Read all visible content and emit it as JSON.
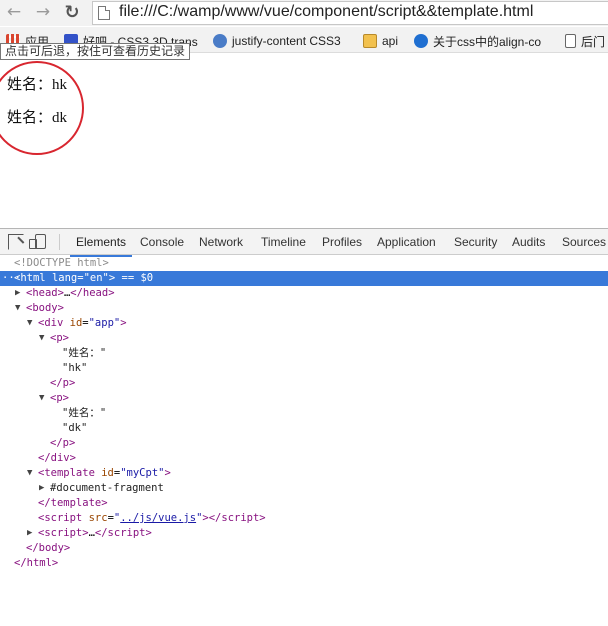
{
  "browser": {
    "url": "file:///C:/wamp/www/vue/component/script&&template.html",
    "tooltip": "点击可后退，按住可查看历史记录",
    "bookmarks": [
      {
        "label": "应用",
        "icon": "apps-icon"
      },
      {
        "label": "好吧 - CSS3 3D trans",
        "icon": "baidu-icon"
      },
      {
        "label": "justify-content CSS3",
        "icon": "compass-icon"
      },
      {
        "label": "api",
        "icon": "folder-icon"
      },
      {
        "label": "关于css中的align-co",
        "icon": "ie-icon"
      },
      {
        "label": "后门",
        "icon": "page-icon"
      }
    ]
  },
  "page": {
    "lines": [
      "姓名：hk",
      "姓名：dk"
    ]
  },
  "devtools": {
    "tabs": [
      "Elements",
      "Console",
      "Network",
      "Timeline",
      "Profiles",
      "Application",
      "Security",
      "Audits",
      "Sources"
    ],
    "active_tab": "Elements",
    "dom_lines": [
      {
        "indent": 14,
        "html": "<span class='comm'>&lt;!DOCTYPE html&gt;</span>"
      },
      {
        "indent": 14,
        "sel": true,
        "prefix": "···",
        "html": "<span class='tag'>&lt;html</span> <span class='attr'>lang</span>=<span class='val'>\"en\"</span><span class='tag'>&gt;</span> == $0"
      },
      {
        "indent": 26,
        "tri": "▶",
        "html": "<span class='tag'>&lt;head&gt;</span>…<span class='tag'>&lt;/head&gt;</span>"
      },
      {
        "indent": 26,
        "tri": "▼",
        "html": "<span class='tag'>&lt;body&gt;</span>"
      },
      {
        "indent": 38,
        "tri": "▼",
        "html": "<span class='tag'>&lt;div</span> <span class='attr'>id</span>=<span class='val'>\"app\"</span><span class='tag'>&gt;</span>"
      },
      {
        "indent": 50,
        "tri": "▼",
        "html": "<span class='tag'>&lt;p&gt;</span>"
      },
      {
        "indent": 62,
        "html": "<span class='txt'>\"姓名：\"</span>"
      },
      {
        "indent": 62,
        "html": "<span class='txt'>\"hk\"</span>"
      },
      {
        "indent": 50,
        "html": "<span class='tag'>&lt;/p&gt;</span>"
      },
      {
        "indent": 50,
        "tri": "▼",
        "html": "<span class='tag'>&lt;p&gt;</span>"
      },
      {
        "indent": 62,
        "html": "<span class='txt'>\"姓名：\"</span>"
      },
      {
        "indent": 62,
        "html": "<span class='txt'>\"dk\"</span>"
      },
      {
        "indent": 50,
        "html": "<span class='tag'>&lt;/p&gt;</span>"
      },
      {
        "indent": 38,
        "html": "<span class='tag'>&lt;/div&gt;</span>"
      },
      {
        "indent": 38,
        "tri": "▼",
        "html": "<span class='tag'>&lt;template</span> <span class='attr'>id</span>=<span class='val'>\"myCpt\"</span><span class='tag'>&gt;</span>"
      },
      {
        "indent": 50,
        "tri": "▶",
        "html": "<span class='txt'>#document-fragment</span>"
      },
      {
        "indent": 38,
        "html": "<span class='tag'>&lt;/template&gt;</span>"
      },
      {
        "indent": 38,
        "html": "<span class='tag'>&lt;script</span> <span class='attr'>src</span>=<span class='val'>\"<span class='link'>../js/vue.js</span>\"</span><span class='tag'>&gt;&lt;/script&gt;</span>"
      },
      {
        "indent": 38,
        "tri": "▶",
        "html": "<span class='tag'>&lt;script&gt;</span>…<span class='tag'>&lt;/script&gt;</span>"
      },
      {
        "indent": 26,
        "html": "<span class='tag'>&lt;/body&gt;</span>"
      },
      {
        "indent": 14,
        "html": "<span class='tag'>&lt;/html&gt;</span>"
      }
    ]
  },
  "colors": {
    "selection": "#3879d9",
    "circle": "#d8262f",
    "tag": "#881280",
    "attr": "#994500",
    "value": "#1a1aa6"
  }
}
